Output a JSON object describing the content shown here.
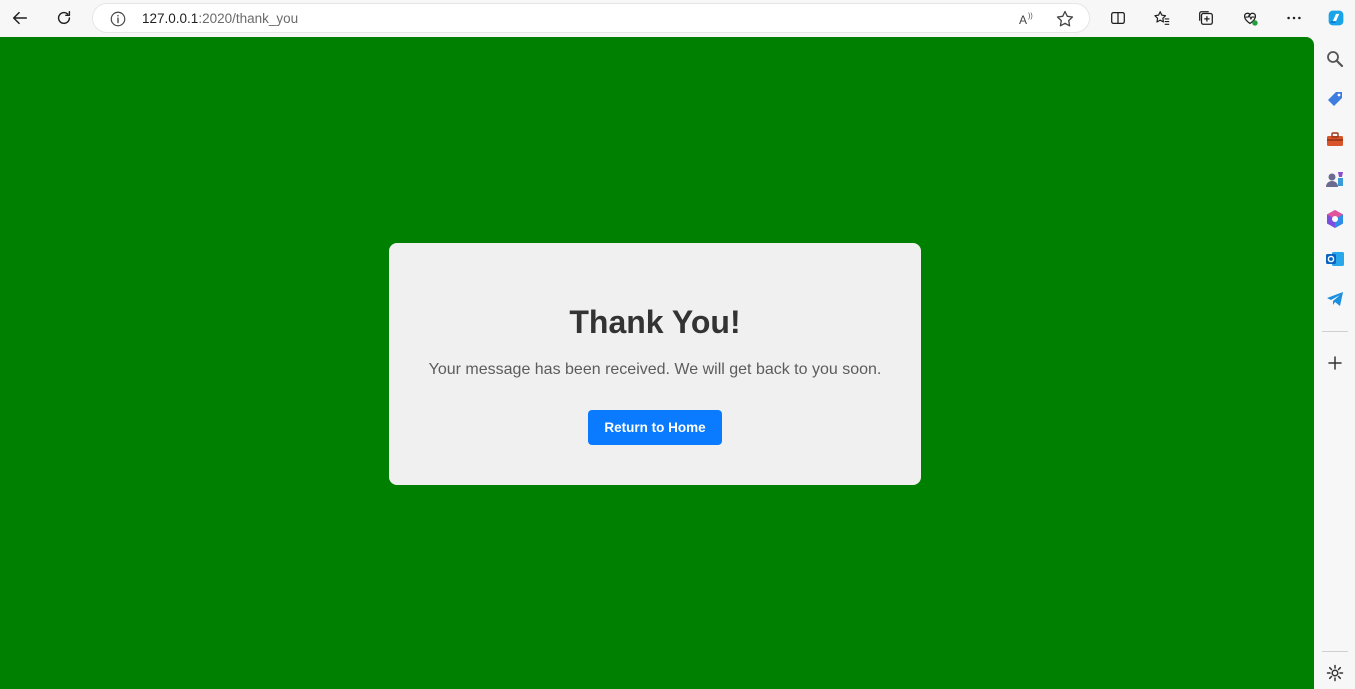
{
  "browser": {
    "url_host": "127.0.0.1",
    "url_rest": ":2020/thank_you",
    "icons": [
      "back-icon",
      "refresh-icon",
      "site-info-icon",
      "read-aloud-icon",
      "favorite-star-icon",
      "split-screen-icon",
      "favorites-icon",
      "collections-icon",
      "browser-health-icon",
      "more-icon",
      "copilot-icon"
    ]
  },
  "card": {
    "title": "Thank You!",
    "message": "Your message has been received. We will get back to you soon.",
    "button_label": "Return to Home"
  },
  "colors": {
    "page_background": "#008000",
    "card_background": "#f0f0f0",
    "button_background": "#0a7bff"
  },
  "sidebar": {
    "icons": [
      "search-icon",
      "shopping-tag-icon",
      "tools-icon",
      "games-icon",
      "office-icon",
      "outlook-icon",
      "telegram-icon",
      "add-icon",
      "settings-icon"
    ]
  }
}
